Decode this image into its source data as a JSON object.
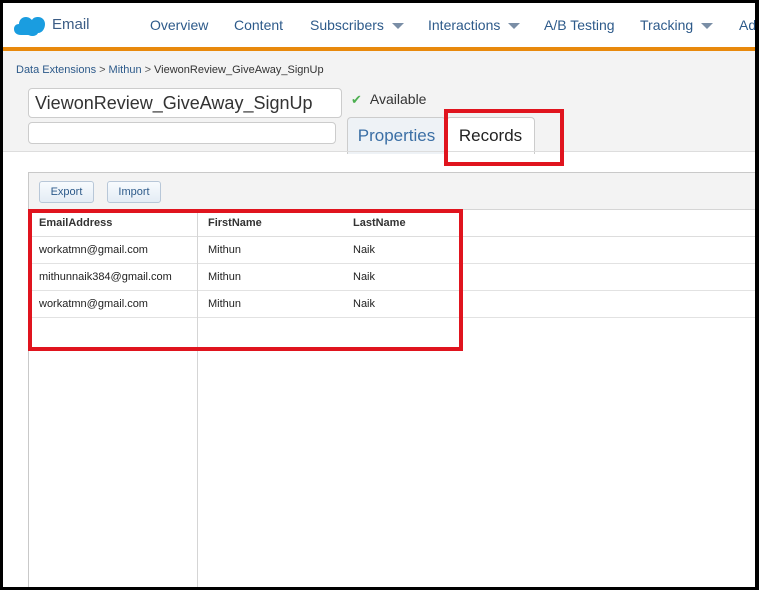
{
  "app": {
    "name": "Email"
  },
  "nav": [
    {
      "label": "Overview",
      "dropdown": false
    },
    {
      "label": "Content",
      "dropdown": false
    },
    {
      "label": "Subscribers",
      "dropdown": true
    },
    {
      "label": "Interactions",
      "dropdown": true
    },
    {
      "label": "A/B Testing",
      "dropdown": false
    },
    {
      "label": "Tracking",
      "dropdown": true
    },
    {
      "label": "Ad",
      "dropdown": false
    }
  ],
  "breadcrumb": [
    "Data Extensions",
    "Mithun",
    "ViewonReview_GiveAway_SignUp"
  ],
  "extension": {
    "name": "ViewonReview_GiveAway_SignUp",
    "description": "",
    "status": "Available"
  },
  "tabs": [
    {
      "label": "Properties",
      "active": false
    },
    {
      "label": "Records",
      "active": true
    }
  ],
  "toolbar": {
    "export_label": "Export",
    "import_label": "Import"
  },
  "table": {
    "columns": [
      "EmailAddress",
      "FirstName",
      "LastName"
    ],
    "rows": [
      [
        "workatmn@gmail.com",
        "Mithun",
        "Naik"
      ],
      [
        "mithunnaik384@gmail.com",
        "Mithun",
        "Naik"
      ],
      [
        "workatmn@gmail.com",
        "Mithun",
        "Naik"
      ]
    ]
  },
  "colors": {
    "accent": "#e8890c",
    "highlight": "#e0141e",
    "link": "#2d5a8a"
  }
}
